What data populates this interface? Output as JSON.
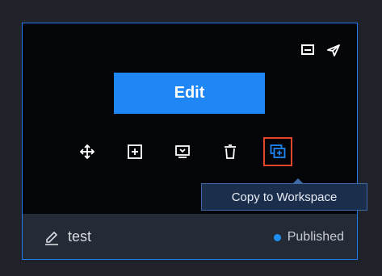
{
  "card": {
    "edit_label": "Edit",
    "top_icons": [
      "preview-screen-icon",
      "send-icon"
    ],
    "tools": [
      "move-icon",
      "add-frame-icon",
      "monitor-icon",
      "trash-icon",
      "copy-to-workspace-icon"
    ],
    "tooltip": "Copy to Workspace",
    "name": "test",
    "status": "Published",
    "status_color": "#1e8ff0"
  },
  "colors": {
    "accent": "#1f86f5",
    "highlight": "#e0482a",
    "card_border": "#1e7cf0"
  }
}
